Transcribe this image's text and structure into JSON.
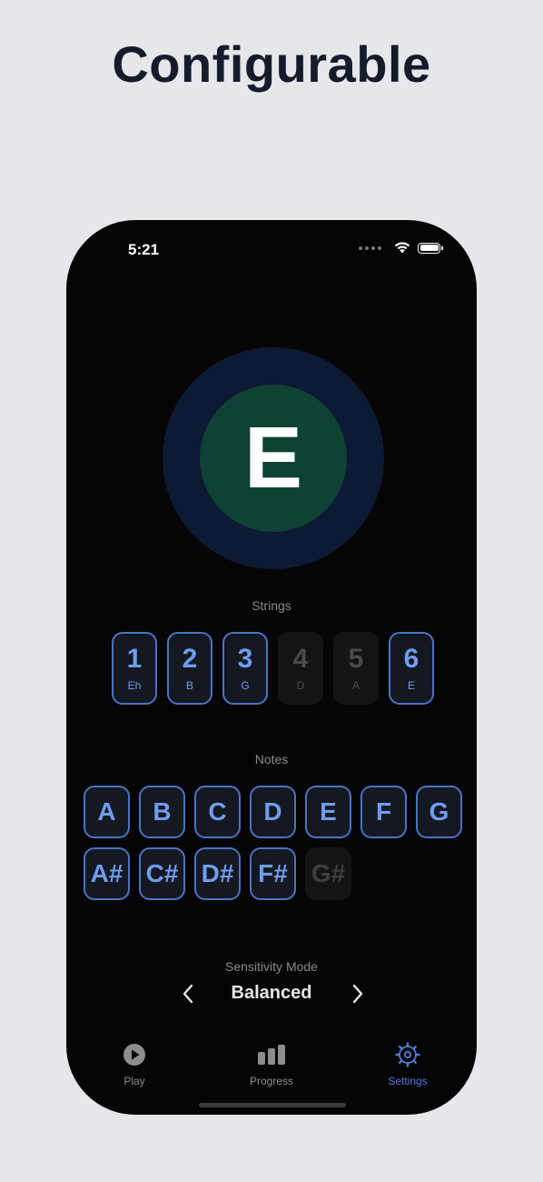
{
  "headline": "Configurable",
  "status": {
    "time": "5:21"
  },
  "current_note": "E",
  "strings": {
    "label": "Strings",
    "items": [
      {
        "number": "1",
        "note": "Eh",
        "enabled": true
      },
      {
        "number": "2",
        "note": "B",
        "enabled": true
      },
      {
        "number": "3",
        "note": "G",
        "enabled": true
      },
      {
        "number": "4",
        "note": "D",
        "enabled": false
      },
      {
        "number": "5",
        "note": "A",
        "enabled": false
      },
      {
        "number": "6",
        "note": "E",
        "enabled": true
      }
    ]
  },
  "notes": {
    "label": "Notes",
    "items": [
      {
        "note": "A",
        "enabled": true
      },
      {
        "note": "B",
        "enabled": true
      },
      {
        "note": "C",
        "enabled": true
      },
      {
        "note": "D",
        "enabled": true
      },
      {
        "note": "E",
        "enabled": true
      },
      {
        "note": "F",
        "enabled": true
      },
      {
        "note": "G",
        "enabled": true
      },
      {
        "note": "A#",
        "enabled": true
      },
      {
        "note": "C#",
        "enabled": true
      },
      {
        "note": "D#",
        "enabled": true
      },
      {
        "note": "F#",
        "enabled": true
      },
      {
        "note": "G#",
        "enabled": false
      }
    ]
  },
  "sensitivity": {
    "label": "Sensitivity Mode",
    "value": "Balanced"
  },
  "tabs": [
    {
      "label": "Play",
      "icon": "play-icon",
      "active": false
    },
    {
      "label": "Progress",
      "icon": "bar-chart-icon",
      "active": false
    },
    {
      "label": "Settings",
      "icon": "gear-icon",
      "active": true
    }
  ],
  "colors": {
    "accent": "#4f7cd6",
    "note_circle": "#0f4134",
    "note_ring": "#0d1a33",
    "screen_bg": "#050505"
  }
}
